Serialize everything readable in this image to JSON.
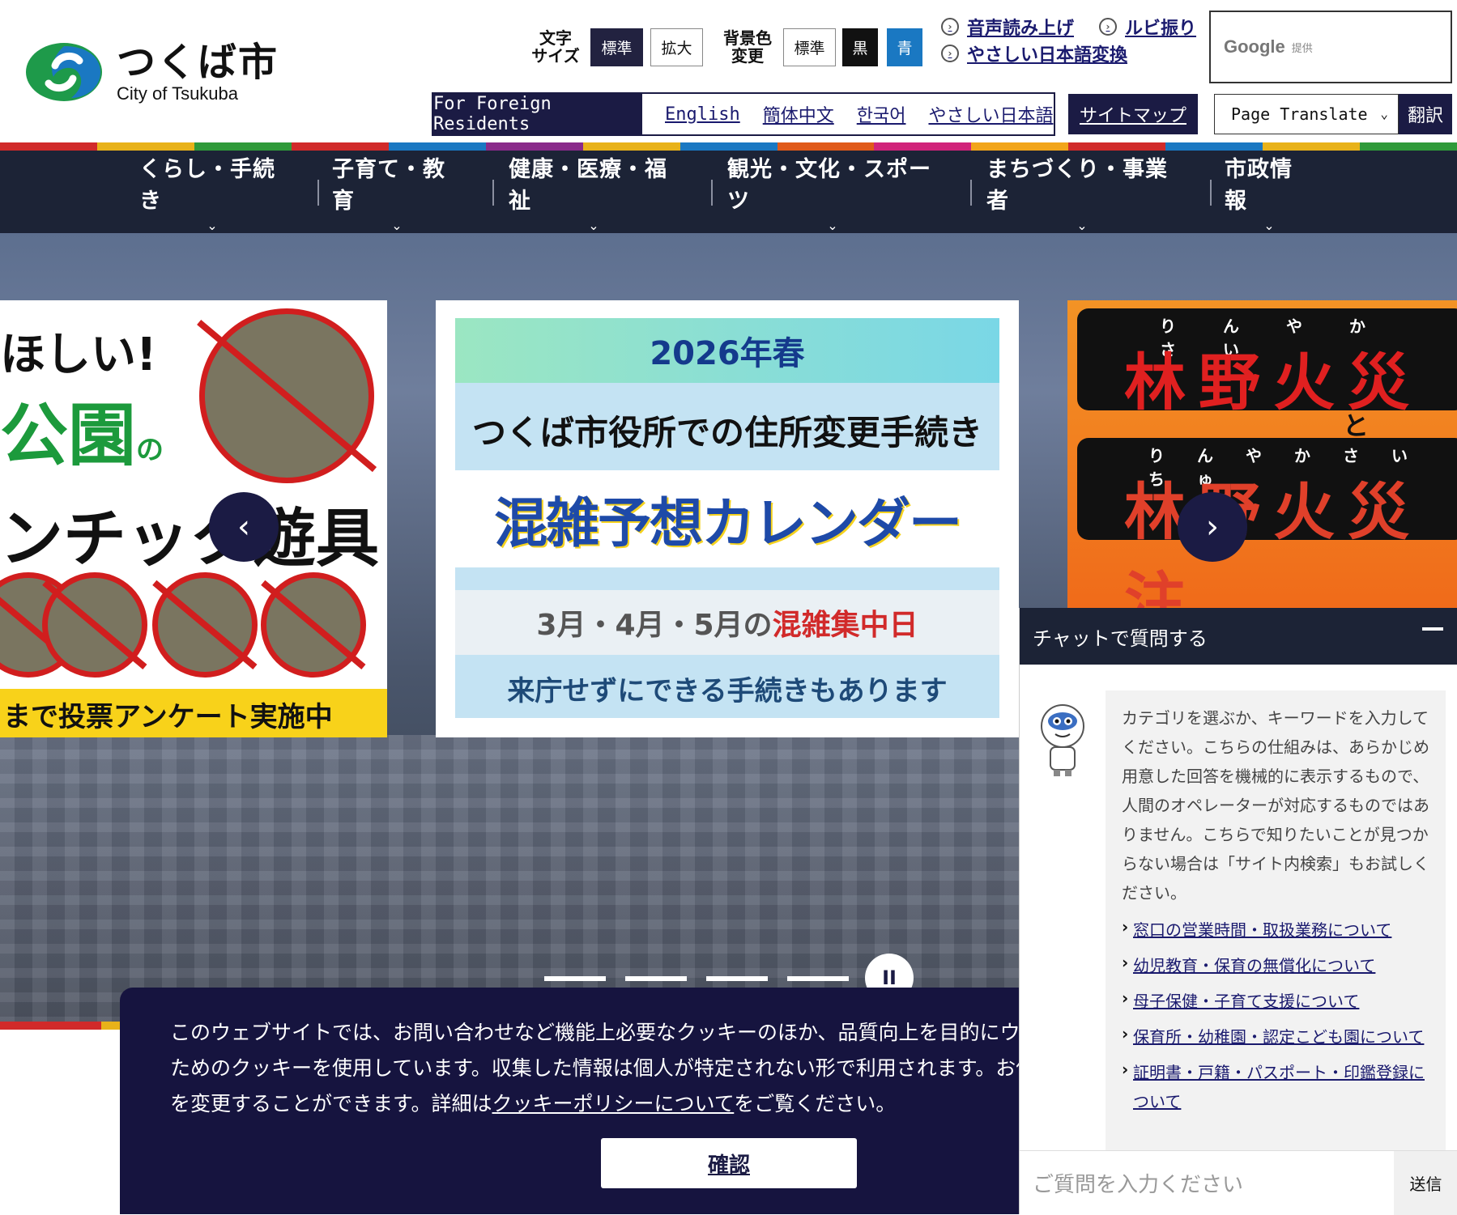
{
  "header": {
    "logo_jp": "つくば市",
    "logo_en": "City of Tsukuba",
    "text_size": {
      "label_line1": "文字",
      "label_line2": "サイズ",
      "standard": "標準",
      "large": "拡大"
    },
    "bg_color": {
      "label_line1": "背景色",
      "label_line2": "変更",
      "standard": "標準",
      "black": "黒",
      "blue": "青"
    },
    "links": {
      "voice": "音声読み上げ",
      "ruby": "ルビ振り",
      "easy_japanese": "やさしい日本語変換"
    },
    "google": {
      "word": "Google",
      "provided": "提供"
    },
    "foreign": {
      "title": "For Foreign Residents",
      "english": "English",
      "chinese": "簡体中文",
      "korean": "한국어",
      "easy": "やさしい日本語"
    },
    "sitemap": "サイトマップ",
    "translate": {
      "select": "Page Translate",
      "button": "翻訳"
    }
  },
  "stripe_colors": [
    "#d12a2a",
    "#e8b21a",
    "#2f9a3a",
    "#d12a2a",
    "#1a78c2",
    "#8a2a8a",
    "#e8b21a",
    "#1a78c2",
    "#e05a1a",
    "#d1237a",
    "#f2a51a",
    "#d12a2a",
    "#1a78c2",
    "#e8b21a",
    "#2f9a3a"
  ],
  "nav": [
    {
      "label": "くらし・手続き"
    },
    {
      "label": "子育て・教育"
    },
    {
      "label": "健康・医療・福祉"
    },
    {
      "label": "観光・文化・スポーツ"
    },
    {
      "label": "まちづくり・事業者"
    },
    {
      "label": "市政情報"
    }
  ],
  "hero": {
    "left_slide": {
      "line1": "ほしい!",
      "line2_main": "公園",
      "line2_small": "の",
      "line3": "ンチック遊具",
      "bottom": "まで投票アンケート実施中",
      "ban_label": "⚠使用禁止⚠"
    },
    "center_slide": {
      "year": "2026年春",
      "sub": "つくば市役所での住所変更手続き",
      "banner": "混雑予想カレンダー",
      "dates_prefix": "3月・4月・5月の",
      "dates_red": "混雑集中日",
      "note": "来庁せずにできる手続きもあります"
    },
    "right_slide": {
      "ruby1": "りんやかさい",
      "big1": "林野火災",
      "to": "と",
      "ruby2": "りんやかさいちゅ",
      "big2": "林野火災注"
    },
    "prev_icon": "‹",
    "next_icon": "›",
    "pause_icon": "II"
  },
  "cookie": {
    "line1": "このウェブサイトでは、お問い合わせなど機能上必要なクッキーのほか、品質向上を目的にウェブ",
    "line2": "ためのクッキーを使用しています。収集した情報は個人が特定されない形で利用されます。お使い",
    "line3_prefix": "を変更することができます。詳細は",
    "line3_link": "クッキーポリシーについて",
    "line3_suffix": "をご覧ください。",
    "confirm": "確認"
  },
  "chat": {
    "title": "チャットで質問する",
    "message": "カテゴリを選ぶか、キーワードを入力してください。こちらの仕組みは、あらかじめ用意した回答を機械的に表示するもので、人間のオペレーターが対応するものではありません。こちらで知りたいことが見つからない場合は「サイト内検索」もお試しください。",
    "links": [
      "窓口の営業時間・取扱業務について",
      "幼児教育・保育の無償化について",
      "母子保健・子育て支援について",
      "保育所・幼稚園・認定こども園について",
      "証明書・戸籍・パスポート・印鑑登録について"
    ],
    "input_placeholder": "ご質問を入力ください",
    "send": "送信"
  }
}
